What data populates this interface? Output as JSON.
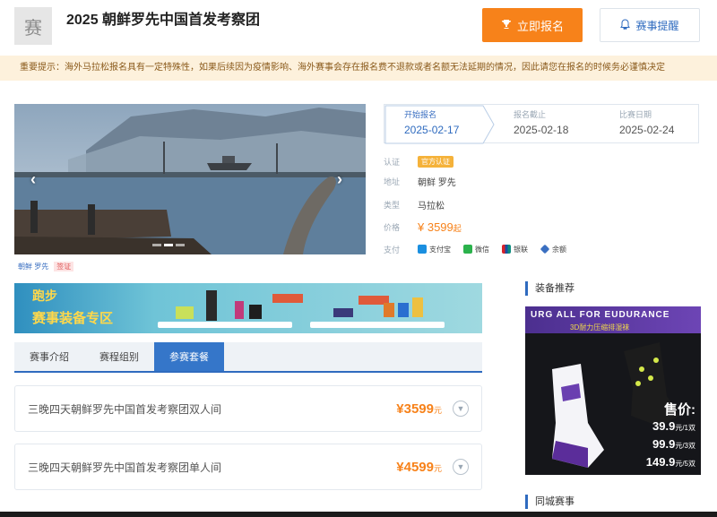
{
  "header": {
    "logo_char": "赛",
    "title": "2025 朝鲜罗先中国首发考察团",
    "signup_label": "立即报名",
    "remind_label": "赛事提醒"
  },
  "notice": "重要提示：海外马拉松报名具有一定特殊性，如果后续因为疫情影响、海外赛事会存在报名费不退款或者名额无法延期的情况，因此请您在报名的时候务必谨慎决定",
  "gallery": {
    "tags": [
      "朝鲜 罗先",
      "签证"
    ]
  },
  "timeline": [
    {
      "label": "开始报名",
      "date": "2025-02-17",
      "active": true
    },
    {
      "label": "报名截止",
      "date": "2025-02-18",
      "active": false
    },
    {
      "label": "比赛日期",
      "date": "2025-02-24",
      "active": false
    }
  ],
  "info": {
    "cert_label": "认证",
    "cert_value": "官方认证",
    "place_label": "地址",
    "place_value": "朝鲜  罗先",
    "type_label": "类型",
    "type_value": "马拉松",
    "price_label": "价格",
    "price_value": "¥ 3599",
    "price_unit": "起",
    "pay_label": "支付",
    "pay_methods": [
      "支付宝",
      "微信",
      "银联",
      "余额"
    ]
  },
  "banner": {
    "line1": "跑步",
    "line2": "赛事装备专区"
  },
  "tabs": [
    "赛事介绍",
    "赛程组别",
    "参赛套餐"
  ],
  "packages": [
    {
      "name": "三晚四天朝鲜罗先中国首发考察团双人间",
      "price": "¥3599",
      "unit": "元"
    },
    {
      "name": "三晚四天朝鲜罗先中国首发考察团单人间",
      "price": "¥4599",
      "unit": "元"
    }
  ],
  "sidebar": {
    "gear_title": "装备推荐",
    "ad_line1": "URG ALL FOR EUDURANCE",
    "ad_line2": "3D耐力压缩排湿袜",
    "ad_sale": "售价:",
    "ad_prices": [
      {
        "price": "39.9",
        "unit": "元/1双"
      },
      {
        "price": "99.9",
        "unit": "元/3双"
      },
      {
        "price": "149.9",
        "unit": "元/5双"
      }
    ],
    "same_city_title": "同城赛事"
  },
  "colors": {
    "accent_orange": "#f7821a",
    "accent_blue": "#2f6bbf",
    "notice_bg": "#fdf1dc"
  }
}
